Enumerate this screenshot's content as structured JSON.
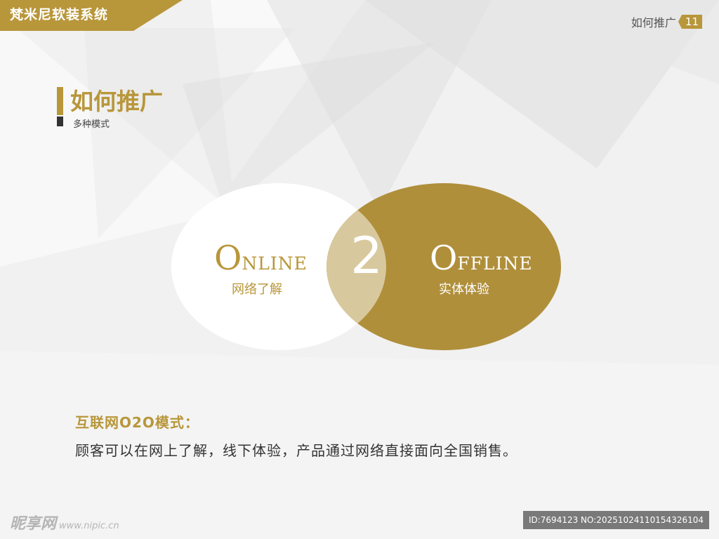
{
  "header": {
    "brand": "梵米尼软装系统",
    "section_title": "如何推广",
    "page_number": "11"
  },
  "slide": {
    "title": "如何推广",
    "subtitle": "多种模式"
  },
  "venn": {
    "center": "2",
    "online": {
      "cap": "O",
      "rest": "NLINE",
      "label": "网络了解"
    },
    "offline": {
      "cap": "O",
      "rest": "FFLINE",
      "label": "实体体验"
    }
  },
  "body": {
    "heading": "互联网O2O模式：",
    "text": "顾客可以在网上了解，线下体验，产品通过网络直接面向全国销售。"
  },
  "watermark": {
    "logo": "昵享网",
    "site": "www.nipic.cn",
    "id_text": "ID:7694123 NO:20251024110154326104"
  },
  "colors": {
    "accent": "#b8963a",
    "dark": "#333333"
  }
}
